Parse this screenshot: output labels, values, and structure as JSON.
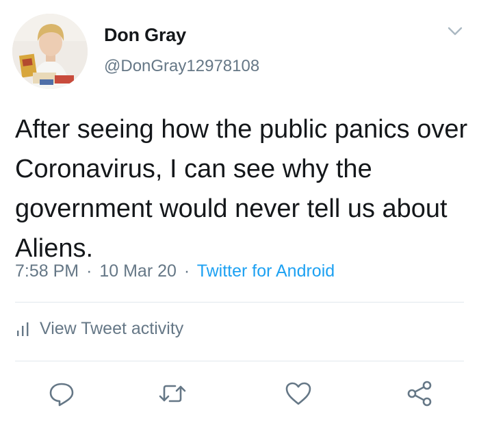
{
  "user": {
    "name": "Don Gray",
    "handle": "@DonGray12978108"
  },
  "tweet": {
    "text": "After seeing how the public panics over Coronavirus, I can see why the government would never tell us about Aliens.",
    "time": "7:58 PM",
    "separator": "·",
    "date": "10 Mar 20",
    "source": "Twitter for Android"
  },
  "activity": {
    "label": "View Tweet activity"
  },
  "actions": [
    "reply-icon",
    "retweet-icon",
    "like-icon",
    "share-icon"
  ],
  "colors": {
    "text": "#14171a",
    "muted": "#657786",
    "link": "#1da1f2",
    "divider": "#e1e8ed"
  }
}
